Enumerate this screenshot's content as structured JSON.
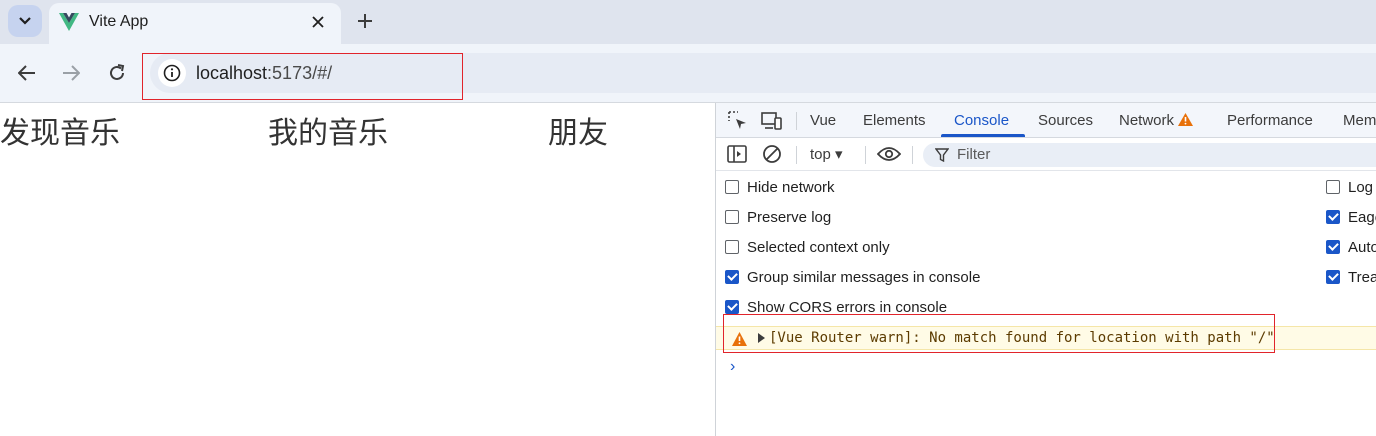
{
  "browser": {
    "tab": {
      "title": "Vite App",
      "close_label": "✕"
    },
    "new_tab_label": "+",
    "address": {
      "host": "localhost",
      "rest": ":5173/#/"
    }
  },
  "page": {
    "nav_links": [
      "发现音乐",
      "我的音乐",
      "朋友"
    ]
  },
  "devtools": {
    "tabs": [
      {
        "label": "Vue",
        "active": false
      },
      {
        "label": "Elements",
        "active": false
      },
      {
        "label": "Console",
        "active": true
      },
      {
        "label": "Sources",
        "active": false
      },
      {
        "label": "Network",
        "active": false,
        "warning": true
      },
      {
        "label": "Performance",
        "active": false
      },
      {
        "label": "Mem",
        "active": false
      }
    ],
    "context": "top ▾",
    "filter_placeholder": "Filter",
    "settings_left": [
      {
        "label": "Hide network",
        "checked": false
      },
      {
        "label": "Preserve log",
        "checked": false
      },
      {
        "label": "Selected context only",
        "checked": false
      },
      {
        "label": "Group similar messages in console",
        "checked": true
      },
      {
        "label": "Show CORS errors in console",
        "checked": true
      }
    ],
    "settings_right": [
      {
        "label": "Log",
        "checked": false
      },
      {
        "label": "Eage",
        "checked": true
      },
      {
        "label": "Auto",
        "checked": true
      },
      {
        "label": "Trea",
        "checked": true
      }
    ],
    "messages": [
      {
        "level": "warning",
        "text": "[Vue Router warn]: No match found for location with path \"/\""
      }
    ],
    "prompt_symbol": "›"
  },
  "colors": {
    "accent": "#1a56c8",
    "highlight_box": "#e1242b",
    "warning": "#e8710a",
    "vue_green": "#41b883",
    "vue_dark": "#34495e"
  }
}
